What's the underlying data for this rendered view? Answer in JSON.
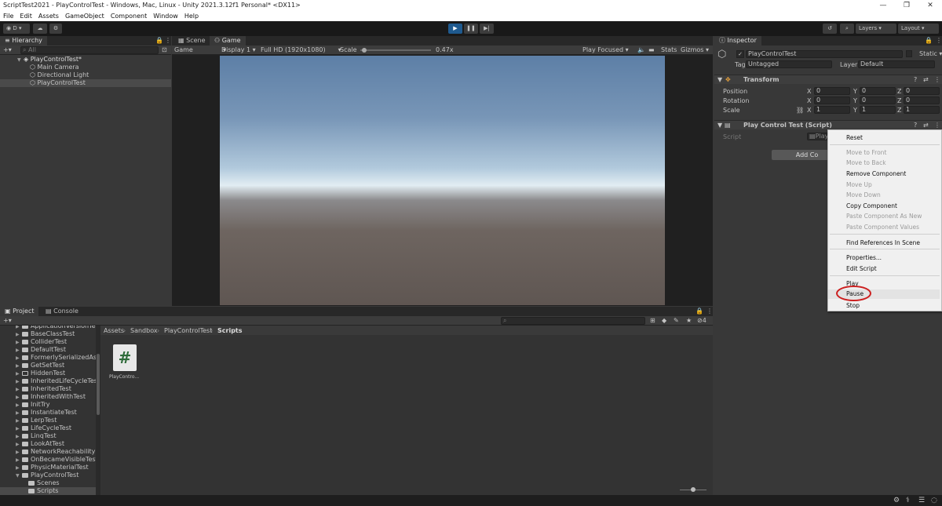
{
  "window": {
    "title": "ScriptTest2021 - PlayControlTest - Windows, Mac, Linux - Unity 2021.3.12f1 Personal* <DX11>"
  },
  "menu": [
    "File",
    "Edit",
    "Assets",
    "GameObject",
    "Component",
    "Window",
    "Help"
  ],
  "toolbar": {
    "account": "D",
    "layers": "Layers",
    "layout": "Layout"
  },
  "hierarchy": {
    "tab": "Hierarchy",
    "search_placeholder": "All",
    "scene": "PlayControlTest*",
    "items": [
      "Main Camera",
      "Directional Light",
      "PlayControlTest"
    ]
  },
  "game": {
    "tabs": [
      "Scene",
      "Game"
    ],
    "display_mode": "Game",
    "display": "Display 1",
    "resolution": "Full HD (1920x1080)",
    "scale_label": "Scale",
    "scale_value": "0.47x",
    "scale_level": 0.05,
    "play_mode": "Play Focused",
    "stats": "Stats",
    "gizmos": "Gizmos"
  },
  "inspector": {
    "tab": "Inspector",
    "object_name": "PlayControlTest",
    "static_label": "Static",
    "tag_label": "Tag",
    "tag_value": "Untagged",
    "layer_label": "Layer",
    "layer_value": "Default",
    "transform": {
      "title": "Transform",
      "rows": [
        {
          "label": "Position",
          "x": "0",
          "y": "0",
          "z": "0"
        },
        {
          "label": "Rotation",
          "x": "0",
          "y": "0",
          "z": "0"
        },
        {
          "label": "Scale",
          "x": "1",
          "y": "1",
          "z": "1"
        }
      ],
      "axis": {
        "x": "X",
        "y": "Y",
        "z": "Z"
      }
    },
    "script_component": {
      "title": "Play Control Test (Script)",
      "script_label": "Script",
      "script_value": "Play"
    },
    "add_component": "Add Co"
  },
  "context_menu": {
    "items": [
      {
        "label": "Reset",
        "enabled": true
      },
      {
        "label": "Move to Front",
        "enabled": false
      },
      {
        "label": "Move to Back",
        "enabled": false
      },
      {
        "label": "Remove Component",
        "enabled": true
      },
      {
        "label": "Move Up",
        "enabled": false
      },
      {
        "label": "Move Down",
        "enabled": false
      },
      {
        "label": "Copy Component",
        "enabled": true
      },
      {
        "label": "Paste Component As New",
        "enabled": false
      },
      {
        "label": "Paste Component Values",
        "enabled": false
      },
      {
        "label": "Find References In Scene",
        "enabled": true
      },
      {
        "label": "Properties...",
        "enabled": true
      },
      {
        "label": "Edit Script",
        "enabled": true
      },
      {
        "label": "Play",
        "enabled": true
      },
      {
        "label": "Pause",
        "enabled": true
      },
      {
        "label": "Stop",
        "enabled": true
      }
    ],
    "highlight_color": "#cc1f1f"
  },
  "project": {
    "tabs": [
      "Project",
      "Console"
    ],
    "breadcrumb": [
      "Assets",
      "Sandbox",
      "PlayControlTest",
      "Scripts"
    ],
    "search_count": "4",
    "tree": [
      "ApplicationVersionTest",
      "BaseClassTest",
      "ColliderTest",
      "DefaultTest",
      "FormerlySerializedAsTe",
      "GetSetTest",
      "HiddenTest",
      "InheritedLifeCycleTest",
      "InheritedTest",
      "InheritedWithTest",
      "InitTry",
      "InstantiateTest",
      "LerpTest",
      "LifeCycleTest",
      "LinqTest",
      "LookAtTest",
      "NetworkReachability",
      "OnBecameVisibleTest",
      "PhysicMaterialTest",
      "PlayControlTest",
      "Scenes",
      "Scripts"
    ],
    "asset": {
      "name": "PlayContro...",
      "glyph": "#"
    }
  }
}
